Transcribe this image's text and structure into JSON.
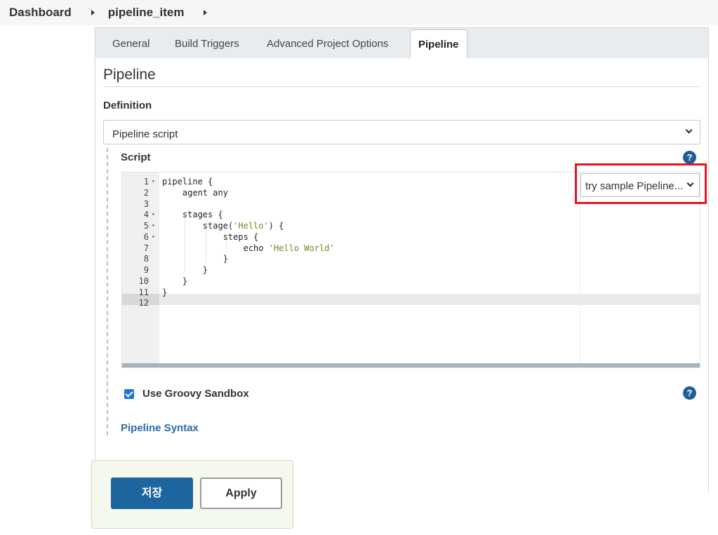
{
  "breadcrumb": {
    "items": [
      "Dashboard",
      "pipeline_item"
    ]
  },
  "tabs": [
    {
      "label": "General",
      "active": false
    },
    {
      "label": "Build Triggers",
      "active": false
    },
    {
      "label": "Advanced Project Options",
      "active": false
    },
    {
      "label": "Pipeline",
      "active": true
    }
  ],
  "pipeline": {
    "section_title": "Pipeline",
    "definition_label": "Definition",
    "definition_value": "Pipeline script",
    "script_label": "Script",
    "help_icon": "?",
    "sample_select_value": "try sample Pipeline...",
    "editor": {
      "lines": [
        {
          "n": "1",
          "fold": true,
          "code": "pipeline {"
        },
        {
          "n": "2",
          "fold": false,
          "code": "    agent any"
        },
        {
          "n": "3",
          "fold": false,
          "code": ""
        },
        {
          "n": "4",
          "fold": true,
          "code": "    stages {"
        },
        {
          "n": "5",
          "fold": true,
          "code": "        stage(",
          "str": "'Hello'",
          "tail": ") {"
        },
        {
          "n": "6",
          "fold": true,
          "code": "            steps {"
        },
        {
          "n": "7",
          "fold": false,
          "code": "                echo ",
          "str": "'Hello World'",
          "tail": ""
        },
        {
          "n": "8",
          "fold": false,
          "code": "            }"
        },
        {
          "n": "9",
          "fold": false,
          "code": "        }"
        },
        {
          "n": "10",
          "fold": false,
          "code": "    }"
        },
        {
          "n": "11",
          "fold": false,
          "code": "}"
        },
        {
          "n": "12",
          "fold": false,
          "code": ""
        }
      ],
      "active_line": "12"
    },
    "sandbox_label": "Use Groovy Sandbox",
    "sandbox_checked": true,
    "syntax_link": "Pipeline Syntax"
  },
  "buttons": {
    "save_label": "저장",
    "apply_label": "Apply"
  },
  "colors": {
    "accent": "#1d659e",
    "highlight": "#e8141f",
    "link": "#2b6ca8"
  },
  "icons": [
    "chevron-down-icon",
    "help-icon",
    "fold-arrow-icon",
    "checkbox-checked-icon",
    "breadcrumb-arrow-icon"
  ]
}
